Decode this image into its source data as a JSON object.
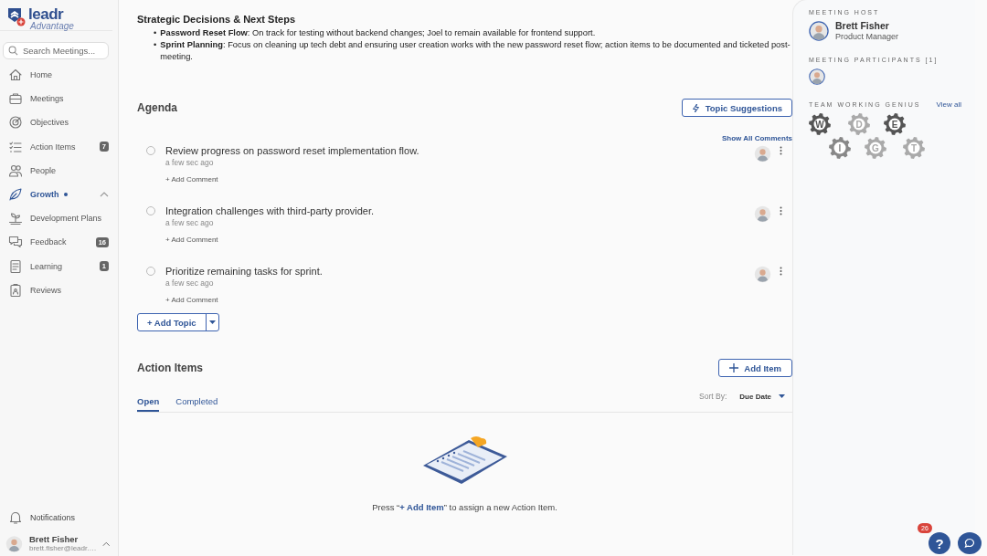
{
  "sidebar": {
    "logo": {
      "name": "leadr",
      "tagline": "Advantage"
    },
    "search": {
      "placeholder": "Search Meetings..."
    },
    "items": [
      {
        "label": "Home",
        "kind": "home",
        "selected": false
      },
      {
        "label": "Meetings",
        "kind": "briefcase",
        "selected": false
      },
      {
        "label": "Objectives",
        "kind": "target",
        "selected": false
      },
      {
        "label": "Action Items",
        "kind": "checklist",
        "selected": false,
        "badge": "7"
      },
      {
        "label": "People",
        "kind": "people",
        "selected": false
      },
      {
        "label": "Growth",
        "kind": "leaf",
        "selected": true,
        "new_dot": true,
        "expanded": true
      },
      {
        "label": "Development Plans",
        "kind": "plant",
        "selected": false
      },
      {
        "label": "Feedback",
        "kind": "chat",
        "selected": false,
        "badge": "16"
      },
      {
        "label": "Learning",
        "kind": "book",
        "selected": false,
        "badge": "1"
      },
      {
        "label": "Reviews",
        "kind": "clipboard",
        "selected": false
      }
    ],
    "notifications": {
      "label": "Notifications"
    },
    "user": {
      "name": "Brett Fisher",
      "email": "brett.fisher@leadr.…"
    }
  },
  "notes": {
    "heading": "Strategic Decisions & Next Steps",
    "bullets": [
      {
        "marker": "•",
        "text": "**Password Reset Flow**: On track for testing without backend changes; Joel to remain available for frontend support."
      },
      {
        "marker": "•",
        "text": "**Sprint Planning**: Focus on cleaning up tech debt and ensuring user creation works with the new password reset flow; action items to be documented and ticketed post-meeting."
      }
    ]
  },
  "agenda": {
    "title": "Agenda",
    "suggest_button": "Topic Suggestions",
    "show_comments": "Show All Comments",
    "topics": [
      {
        "text": "Review progress on password reset implementation flow.",
        "time": "a few sec ago",
        "add_comment": "+ Add Comment",
        "checked": false
      },
      {
        "text": "Integration challenges with third-party provider.",
        "time": "a few sec ago",
        "add_comment": "+ Add Comment",
        "checked": false
      },
      {
        "text": "Prioritize remaining tasks for sprint.",
        "time": "a few sec ago",
        "add_comment": "+ Add Comment",
        "checked": false
      }
    ],
    "add_topic": "+ Add Topic"
  },
  "action_items": {
    "title": "Action Items",
    "add_button": "Add Item",
    "tabs": [
      {
        "label": "Open",
        "selected": true
      },
      {
        "label": "Completed",
        "selected": false
      }
    ],
    "sort_label": "Sort By:",
    "sort_value": "Due Date",
    "empty_text": "Press “**+ Add Item**” to assign a new Action Item."
  },
  "side": {
    "host_label": "MEETING HOST",
    "host": {
      "name": "Brett Fisher",
      "role": "Product Manager"
    },
    "participants_label": "MEETING PARTICIPANTS [1]",
    "genius": {
      "label": "TEAM WORKING GENIUS",
      "view_all": "View all",
      "gears": [
        {
          "letter": "W",
          "kind": "genius"
        },
        {
          "letter": "I",
          "kind": "competency"
        },
        {
          "letter": "D",
          "kind": "frustration"
        },
        {
          "letter": "G",
          "kind": "frustration"
        },
        {
          "letter": "E",
          "kind": "genius"
        },
        {
          "letter": "T",
          "kind": "frustration"
        }
      ]
    }
  },
  "help": {
    "label": "?",
    "badge": "26"
  }
}
